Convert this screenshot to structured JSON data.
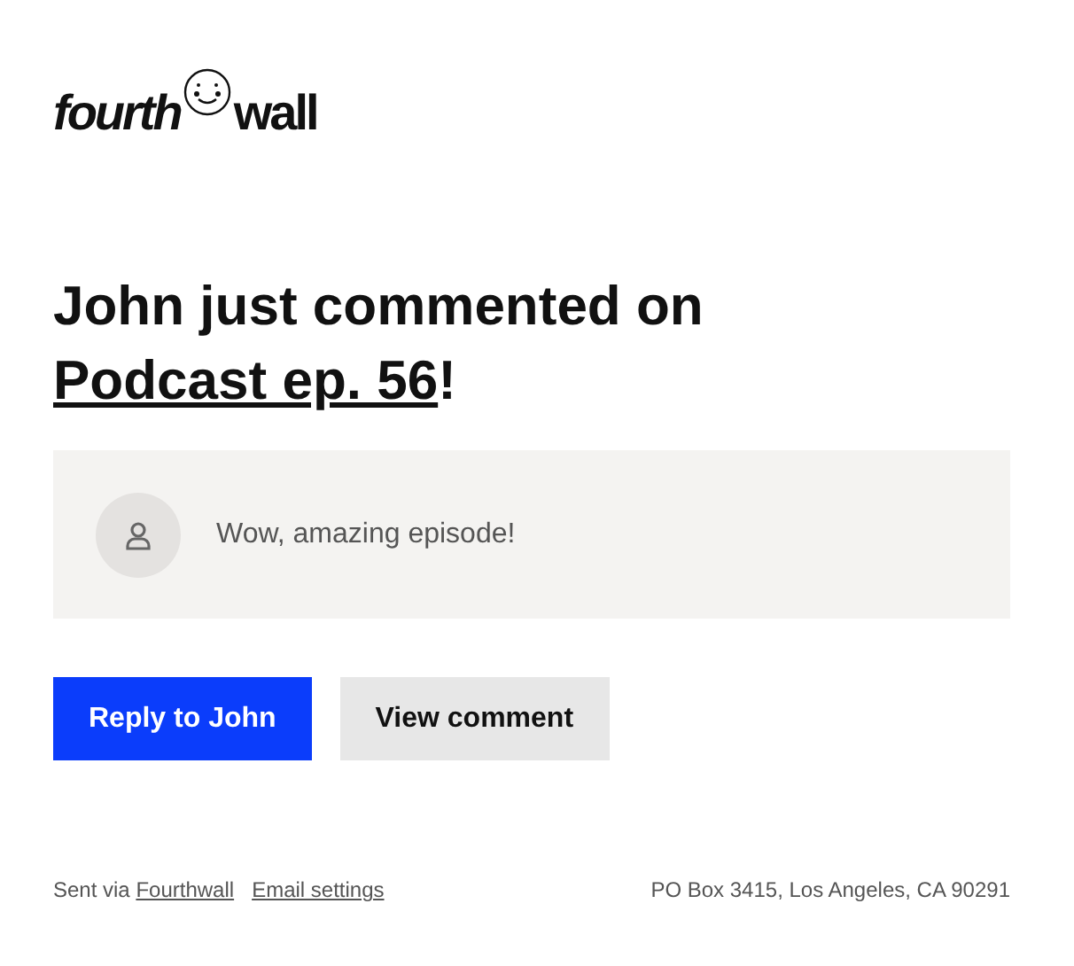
{
  "logo": {
    "left": "fourth",
    "right": "wall"
  },
  "headline": {
    "text": "John just commented on",
    "link": "Podcast ep. 56",
    "suffix": "!"
  },
  "comment": {
    "text": "Wow, amazing episode!"
  },
  "buttons": [
    {
      "label": "Reply to John",
      "kind": "primary"
    },
    {
      "label": "View comment",
      "kind": "secondary"
    }
  ],
  "footer": {
    "sent_via": "Sent via",
    "brand_link": "Fourthwall",
    "settings_link": "Email settings",
    "address": "PO Box 3415, Los Angeles, CA 90291"
  }
}
